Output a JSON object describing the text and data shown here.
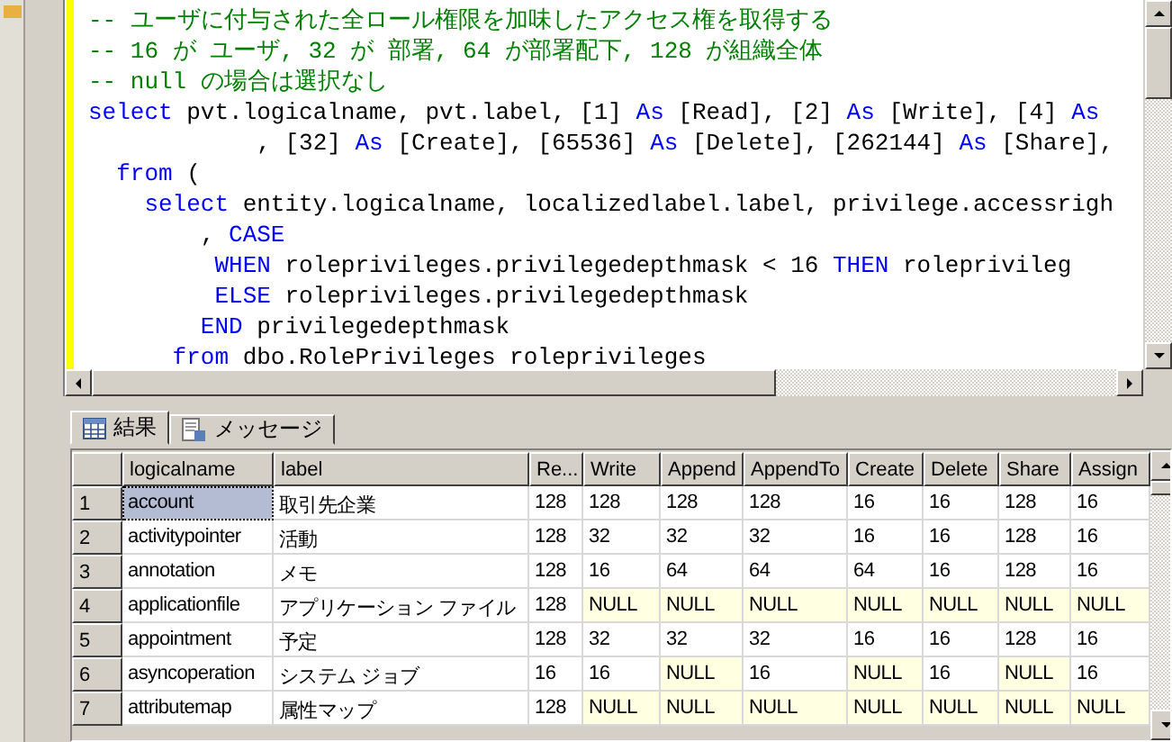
{
  "editor": {
    "lines": [
      [
        {
          "kind": "comment",
          "text": "-- ユーザに付与された全ロール権限を加味したアクセス権を取得する"
        }
      ],
      [
        {
          "kind": "comment",
          "text": "-- 16 が ユーザ, 32 が 部署, 64 が部署配下, 128 が組織全体"
        }
      ],
      [
        {
          "kind": "comment",
          "text": "-- null の場合は選択なし"
        }
      ],
      [
        {
          "kind": "keyword",
          "text": "select"
        },
        {
          "kind": "plain",
          "text": " pvt.logicalname, pvt.label, [1] "
        },
        {
          "kind": "keyword",
          "text": "As"
        },
        {
          "kind": "plain",
          "text": " [Read], [2] "
        },
        {
          "kind": "keyword",
          "text": "As"
        },
        {
          "kind": "plain",
          "text": " [Write], [4] "
        },
        {
          "kind": "keyword",
          "text": "As"
        }
      ],
      [
        {
          "kind": "plain",
          "text": "            , [32] "
        },
        {
          "kind": "keyword",
          "text": "As"
        },
        {
          "kind": "plain",
          "text": " [Create], [65536] "
        },
        {
          "kind": "keyword",
          "text": "As"
        },
        {
          "kind": "plain",
          "text": " [Delete], [262144] "
        },
        {
          "kind": "keyword",
          "text": "As"
        },
        {
          "kind": "plain",
          "text": " [Share],"
        }
      ],
      [
        {
          "kind": "keyword",
          "text": "  from"
        },
        {
          "kind": "plain",
          "text": " ("
        }
      ],
      [
        {
          "kind": "keyword",
          "text": "    select"
        },
        {
          "kind": "plain",
          "text": " entity.logicalname, localizedlabel.label, privilege.accessrigh"
        }
      ],
      [
        {
          "kind": "plain",
          "text": "        , "
        },
        {
          "kind": "keyword",
          "text": "CASE"
        }
      ],
      [
        {
          "kind": "keyword",
          "text": "         WHEN"
        },
        {
          "kind": "plain",
          "text": " roleprivileges.privilegedepthmask < 16 "
        },
        {
          "kind": "keyword",
          "text": "THEN"
        },
        {
          "kind": "plain",
          "text": " roleprivileg"
        }
      ],
      [
        {
          "kind": "keyword",
          "text": "         ELSE"
        },
        {
          "kind": "plain",
          "text": " roleprivileges.privilegedepthmask"
        }
      ],
      [
        {
          "kind": "keyword",
          "text": "        END"
        },
        {
          "kind": "plain",
          "text": " privilegedepthmask"
        }
      ],
      [
        {
          "kind": "keyword",
          "text": "      from"
        },
        {
          "kind": "plain",
          "text": " dbo.RolePrivileges roleprivileges"
        }
      ]
    ]
  },
  "tabs": [
    {
      "label": "結果",
      "kind": "grid",
      "selected": true
    },
    {
      "label": "メッセージ",
      "kind": "message",
      "selected": false
    }
  ],
  "table": {
    "columns": [
      "logicalname",
      "label",
      "Re...",
      "Write",
      "Append",
      "AppendTo",
      "Create",
      "Delete",
      "Share",
      "Assign"
    ],
    "rows": [
      {
        "number": "1",
        "logicalname": "account",
        "selected": true,
        "label": "取引先企業",
        "values": [
          {
            "text": "128",
            "null": false
          },
          {
            "text": "128",
            "null": false
          },
          {
            "text": "128",
            "null": false
          },
          {
            "text": "128",
            "null": false
          },
          {
            "text": "16",
            "null": false
          },
          {
            "text": "16",
            "null": false
          },
          {
            "text": "128",
            "null": false
          },
          {
            "text": "16",
            "null": false
          }
        ]
      },
      {
        "number": "2",
        "logicalname": "activitypointer",
        "selected": false,
        "label": "活動",
        "values": [
          {
            "text": "128",
            "null": false
          },
          {
            "text": "32",
            "null": false
          },
          {
            "text": "32",
            "null": false
          },
          {
            "text": "32",
            "null": false
          },
          {
            "text": "16",
            "null": false
          },
          {
            "text": "16",
            "null": false
          },
          {
            "text": "128",
            "null": false
          },
          {
            "text": "16",
            "null": false
          }
        ]
      },
      {
        "number": "3",
        "logicalname": "annotation",
        "selected": false,
        "label": "メモ",
        "values": [
          {
            "text": "128",
            "null": false
          },
          {
            "text": "16",
            "null": false
          },
          {
            "text": "64",
            "null": false
          },
          {
            "text": "64",
            "null": false
          },
          {
            "text": "64",
            "null": false
          },
          {
            "text": "16",
            "null": false
          },
          {
            "text": "128",
            "null": false
          },
          {
            "text": "16",
            "null": false
          }
        ]
      },
      {
        "number": "4",
        "logicalname": "applicationfile",
        "selected": false,
        "label": "アプリケーション ファイル",
        "values": [
          {
            "text": "128",
            "null": false
          },
          {
            "text": "NULL",
            "null": true
          },
          {
            "text": "NULL",
            "null": true
          },
          {
            "text": "NULL",
            "null": true
          },
          {
            "text": "NULL",
            "null": true
          },
          {
            "text": "NULL",
            "null": true
          },
          {
            "text": "NULL",
            "null": true
          },
          {
            "text": "NULL",
            "null": true
          }
        ]
      },
      {
        "number": "5",
        "logicalname": "appointment",
        "selected": false,
        "label": "予定",
        "values": [
          {
            "text": "128",
            "null": false
          },
          {
            "text": "32",
            "null": false
          },
          {
            "text": "32",
            "null": false
          },
          {
            "text": "32",
            "null": false
          },
          {
            "text": "16",
            "null": false
          },
          {
            "text": "16",
            "null": false
          },
          {
            "text": "128",
            "null": false
          },
          {
            "text": "16",
            "null": false
          }
        ]
      },
      {
        "number": "6",
        "logicalname": "asyncoperation",
        "selected": false,
        "label": "システム ジョブ",
        "values": [
          {
            "text": "16",
            "null": false
          },
          {
            "text": "16",
            "null": false
          },
          {
            "text": "NULL",
            "null": true
          },
          {
            "text": "16",
            "null": false
          },
          {
            "text": "NULL",
            "null": true
          },
          {
            "text": "16",
            "null": false
          },
          {
            "text": "NULL",
            "null": true
          },
          {
            "text": "16",
            "null": false
          }
        ]
      },
      {
        "number": "7",
        "logicalname": "attributemap",
        "selected": false,
        "label": "属性マップ",
        "values": [
          {
            "text": "128",
            "null": false
          },
          {
            "text": "NULL",
            "null": true
          },
          {
            "text": "NULL",
            "null": true
          },
          {
            "text": "NULL",
            "null": true
          },
          {
            "text": "NULL",
            "null": true
          },
          {
            "text": "NULL",
            "null": true
          },
          {
            "text": "NULL",
            "null": true
          },
          {
            "text": "NULL",
            "null": true
          }
        ]
      }
    ]
  }
}
